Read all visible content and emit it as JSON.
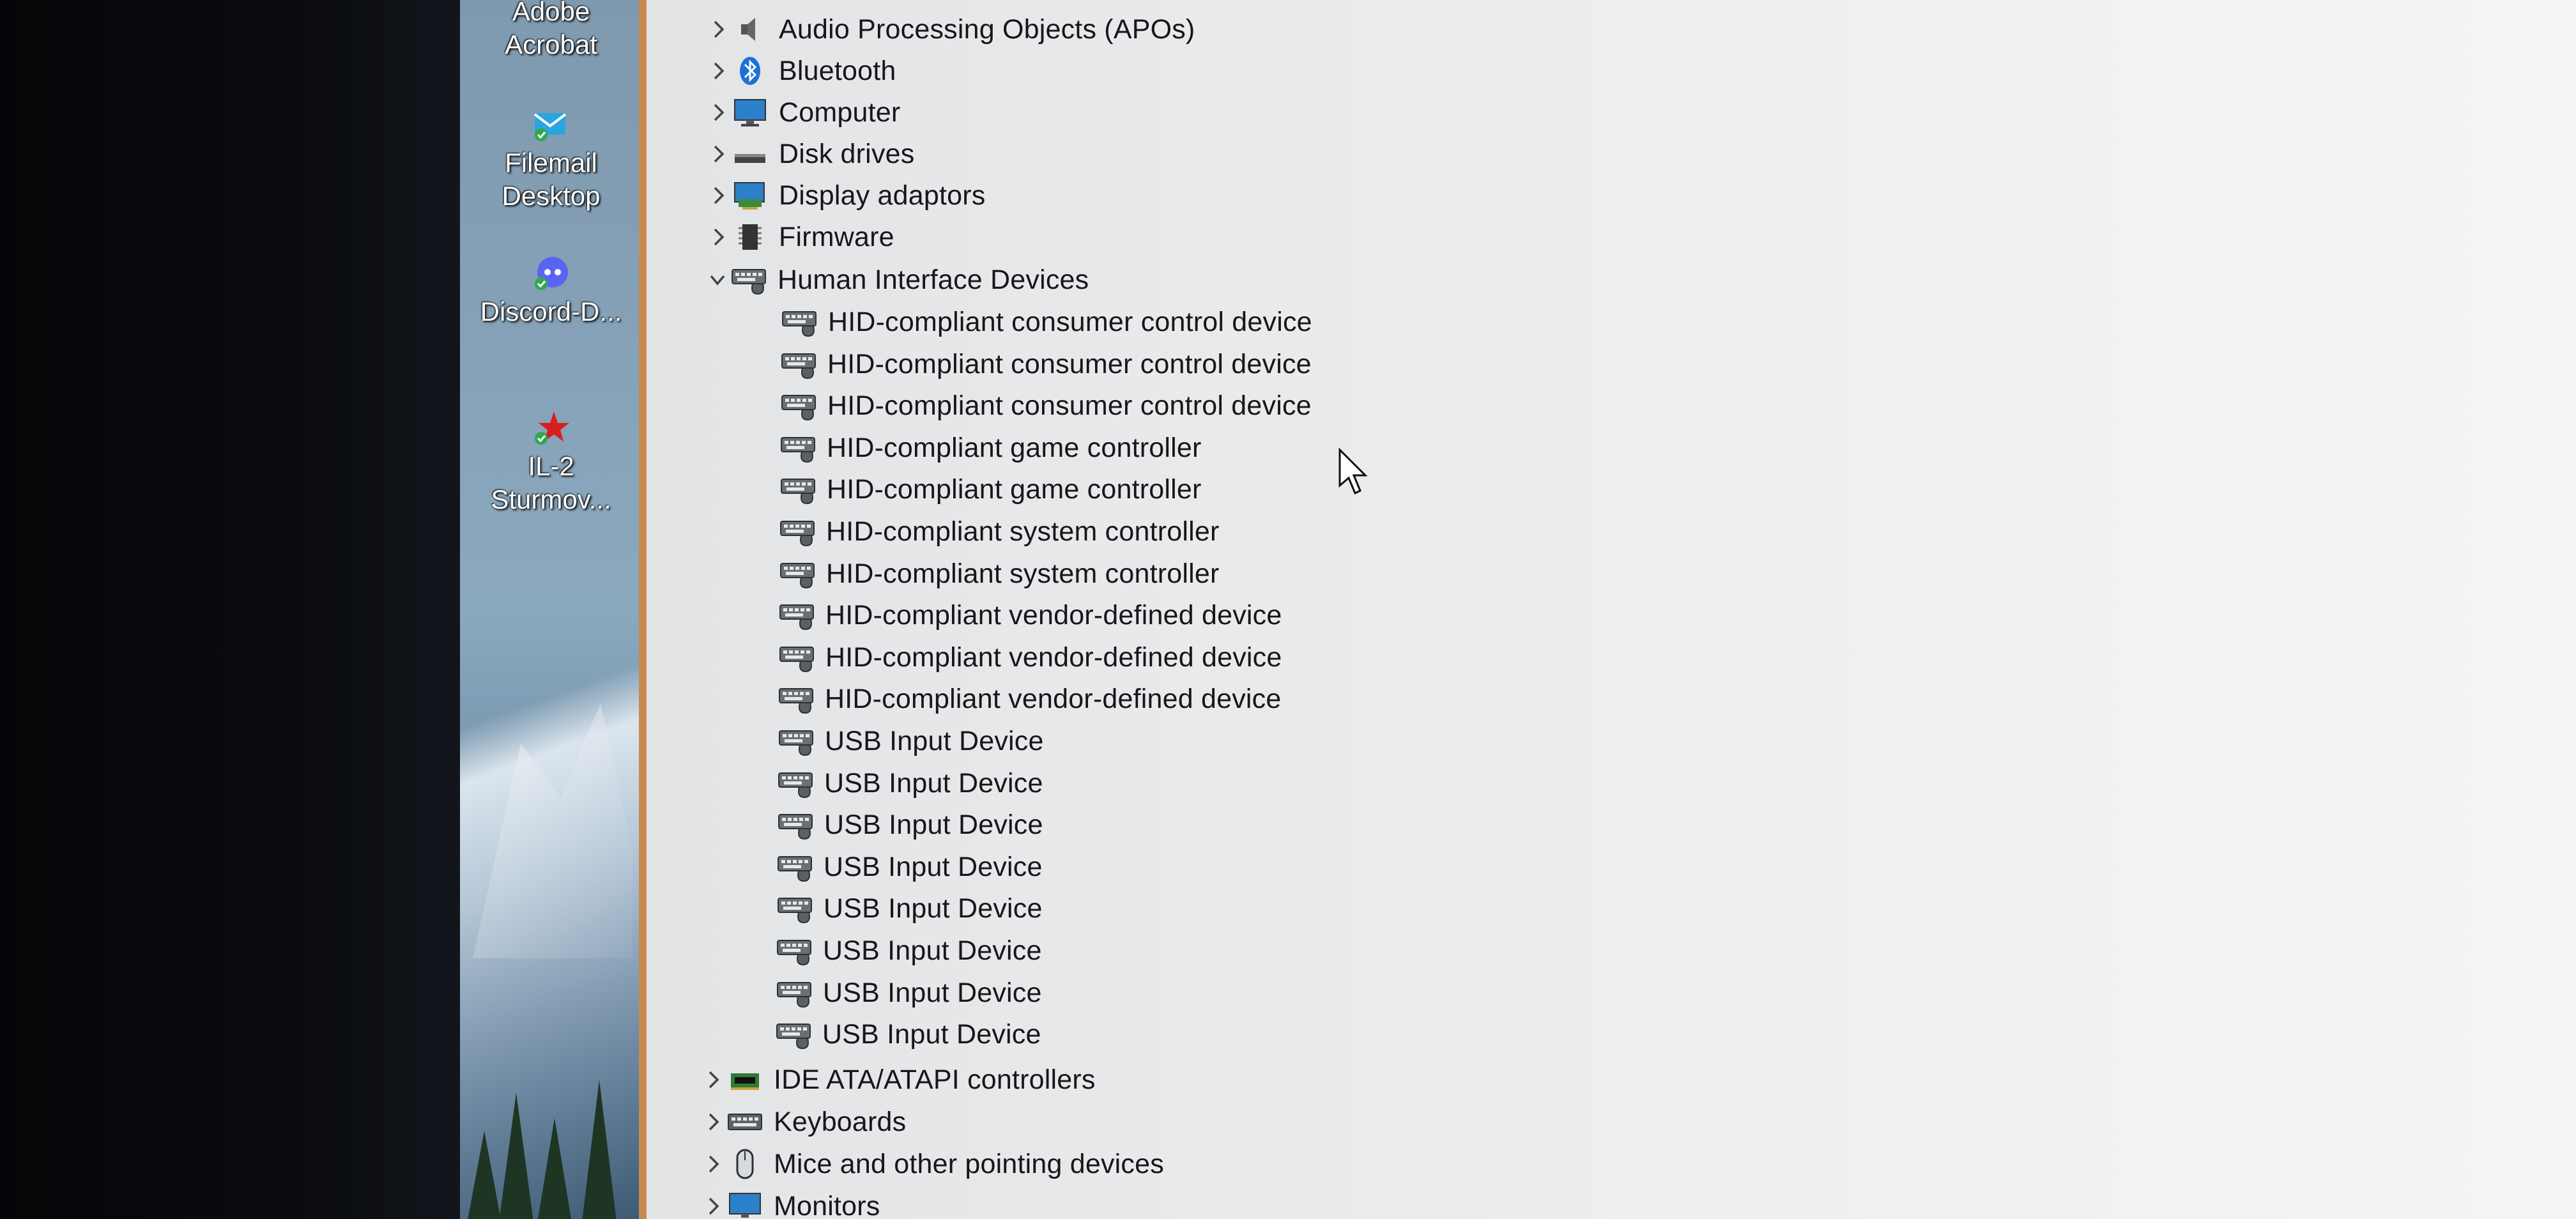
{
  "desktop": {
    "icons": [
      {
        "name": "adobe-acrobat",
        "lines": [
          "Adobe",
          "Acrobat"
        ]
      },
      {
        "name": "filemail-desktop",
        "lines": [
          "Filemail",
          "Desktop"
        ]
      },
      {
        "name": "discord",
        "lines": [
          "Discord-D..."
        ]
      },
      {
        "name": "il2-sturmovik",
        "lines": [
          "IL-2",
          "Sturmov..."
        ]
      }
    ]
  },
  "tree": {
    "categories_top": [
      {
        "label": "Audio Processing Objects (APOs)",
        "icon": "speaker-icon"
      },
      {
        "label": "Bluetooth",
        "icon": "bluetooth-icon"
      },
      {
        "label": "Computer",
        "icon": "monitor-icon"
      },
      {
        "label": "Disk drives",
        "icon": "disk-drive-icon"
      },
      {
        "label": "Display adaptors",
        "icon": "display-adapter-icon"
      },
      {
        "label": "Firmware",
        "icon": "chip-icon"
      }
    ],
    "expanded_category": {
      "label": "Human Interface Devices",
      "icon": "hid-icon"
    },
    "hid_children": [
      "HID-compliant consumer control device",
      "HID-compliant consumer control device",
      "HID-compliant consumer control device",
      "HID-compliant game controller",
      "HID-compliant game controller",
      "HID-compliant system controller",
      "HID-compliant system controller",
      "HID-compliant vendor-defined device",
      "HID-compliant vendor-defined device",
      "HID-compliant vendor-defined device",
      "USB Input Device",
      "USB Input Device",
      "USB Input Device",
      "USB Input Device",
      "USB Input Device",
      "USB Input Device",
      "USB Input Device",
      "USB Input Device"
    ],
    "categories_bottom": [
      {
        "label": "IDE ATA/ATAPI controllers",
        "icon": "ide-controller-icon"
      },
      {
        "label": "Keyboards",
        "icon": "keyboard-icon"
      },
      {
        "label": "Mice and other pointing devices",
        "icon": "mouse-icon"
      },
      {
        "label": "Monitors",
        "icon": "monitor-icon"
      }
    ]
  },
  "colors": {
    "panel_bg": "#ececec",
    "text": "#15171b",
    "window_edge": "#c68a4f"
  }
}
